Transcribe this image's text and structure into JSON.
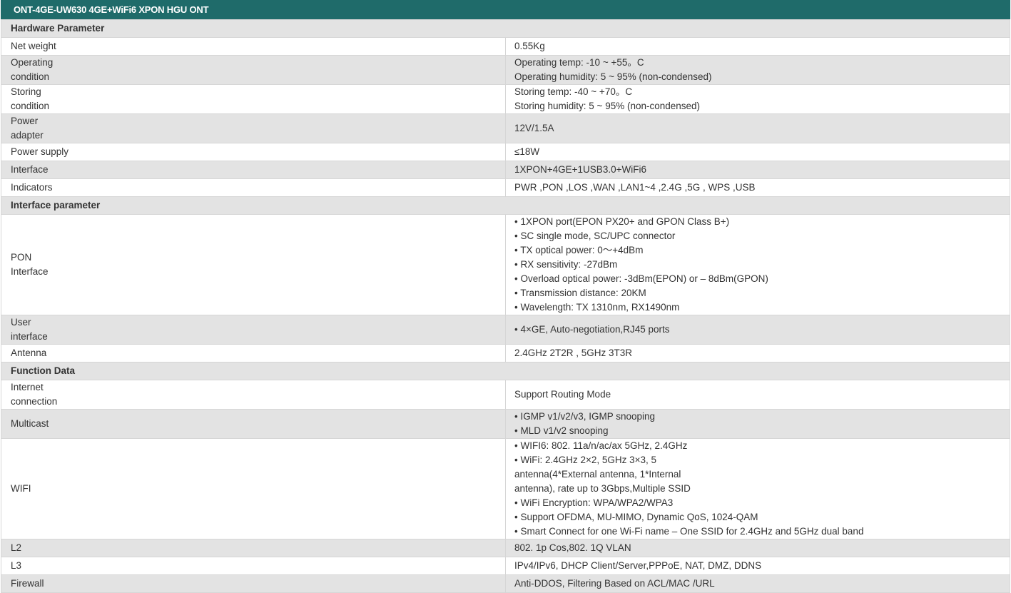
{
  "title": "ONT-4GE-UW630 4GE+WiFi6 XPON HGU ONT",
  "rows": [
    {
      "type": "section",
      "label": "Hardware Parameter",
      "h": 25,
      "bg": "gray"
    },
    {
      "type": "data",
      "label": [
        "Net weight"
      ],
      "value": [
        "0.55Kg"
      ],
      "h": 25,
      "bg": "white"
    },
    {
      "type": "data",
      "label": [
        "Operating",
        "condition"
      ],
      "value": [
        "Operating temp: -10 ~ +55。C",
        "Operating humidity: 5 ~ 95% (non-condensed)"
      ],
      "h": 41,
      "bg": "gray"
    },
    {
      "type": "data",
      "label": [
        "Storing",
        "condition"
      ],
      "value": [
        "Storing temp: -40 ~ +70。C",
        "Storing humidity: 5 ~ 95% (non-condensed)"
      ],
      "h": 41,
      "bg": "white"
    },
    {
      "type": "data",
      "label": [
        "Power",
        "adapter"
      ],
      "value": [
        "12V/1.5A"
      ],
      "h": 41,
      "bg": "gray"
    },
    {
      "type": "data",
      "label": [
        "Power supply"
      ],
      "value": [
        "≤18W"
      ],
      "h": 25,
      "bg": "white"
    },
    {
      "type": "data",
      "label": [
        "Interface"
      ],
      "value": [
        "1XPON+4GE+1USB3.0+WiFi6"
      ],
      "h": 25,
      "bg": "gray"
    },
    {
      "type": "data",
      "label": [
        "Indicators"
      ],
      "value": [
        "PWR ,PON ,LOS ,WAN ,LAN1~4 ,2.4G ,5G , WPS ,USB"
      ],
      "h": 25,
      "bg": "white"
    },
    {
      "type": "section",
      "label": "Interface parameter",
      "h": 25,
      "bg": "gray"
    },
    {
      "type": "data",
      "label": [
        "PON",
        "Interface"
      ],
      "value": [
        "• 1XPON port(EPON PX20+ and GPON Class B+)",
        "• SC single mode, SC/UPC connector",
        "• TX optical power: 0～+4dBm",
        "• RX sensitivity: -27dBm",
        "• Overload optical power: -3dBm(EPON) or – 8dBm(GPON)",
        "• Transmission distance: 20KM",
        "• Wavelength: TX 1310nm, RX1490nm"
      ],
      "h": 140,
      "bg": "white"
    },
    {
      "type": "data",
      "label": [
        "User",
        "interface"
      ],
      "value": [
        "• 4×GE, Auto-negotiation,RJ45 ports"
      ],
      "h": 41,
      "bg": "gray"
    },
    {
      "type": "data",
      "label": [
        "Antenna"
      ],
      "value": [
        "2.4GHz 2T2R , 5GHz 3T3R"
      ],
      "h": 25,
      "bg": "white"
    },
    {
      "type": "section",
      "label": "Function Data",
      "h": 25,
      "bg": "gray"
    },
    {
      "type": "data",
      "label": [
        "Internet",
        "connection"
      ],
      "value": [
        "Support Routing Mode"
      ],
      "h": 41,
      "bg": "white"
    },
    {
      "type": "data",
      "label": [
        "Multicast"
      ],
      "value": [
        "• IGMP v1/v2/v3, IGMP snooping",
        "• MLD v1/v2 snooping"
      ],
      "h": 41,
      "bg": "gray"
    },
    {
      "type": "data",
      "label": [
        "WIFI"
      ],
      "value": [
        "• WIFI6: 802. 11a/n/ac/ax 5GHz, 2.4GHz",
        "• WiFi: 2.4GHz 2×2, 5GHz 3×3, 5",
        "antenna(4*External antenna, 1*Internal",
        "antenna), rate up to 3Gbps,Multiple SSID",
        "• WiFi Encryption: WPA/WPA2/WPA3",
        "• Support OFDMA, MU-MIMO, Dynamic QoS, 1024-QAM",
        "• Smart Connect for one Wi-Fi name – One SSID for 2.4GHz and 5GHz dual band"
      ],
      "h": 140,
      "bg": "white"
    },
    {
      "type": "data",
      "label": [
        "L2"
      ],
      "value": [
        "802. 1p Cos,802. 1Q VLAN"
      ],
      "h": 25,
      "bg": "gray"
    },
    {
      "type": "data",
      "label": [
        "L3"
      ],
      "value": [
        "IPv4/IPv6, DHCP Client/Server,PPPoE, NAT, DMZ, DDNS"
      ],
      "h": 25,
      "bg": "white"
    },
    {
      "type": "data",
      "label": [
        "Firewall"
      ],
      "value": [
        "Anti-DDOS, Filtering Based on ACL/MAC /URL"
      ],
      "h": 25,
      "bg": "gray"
    }
  ]
}
